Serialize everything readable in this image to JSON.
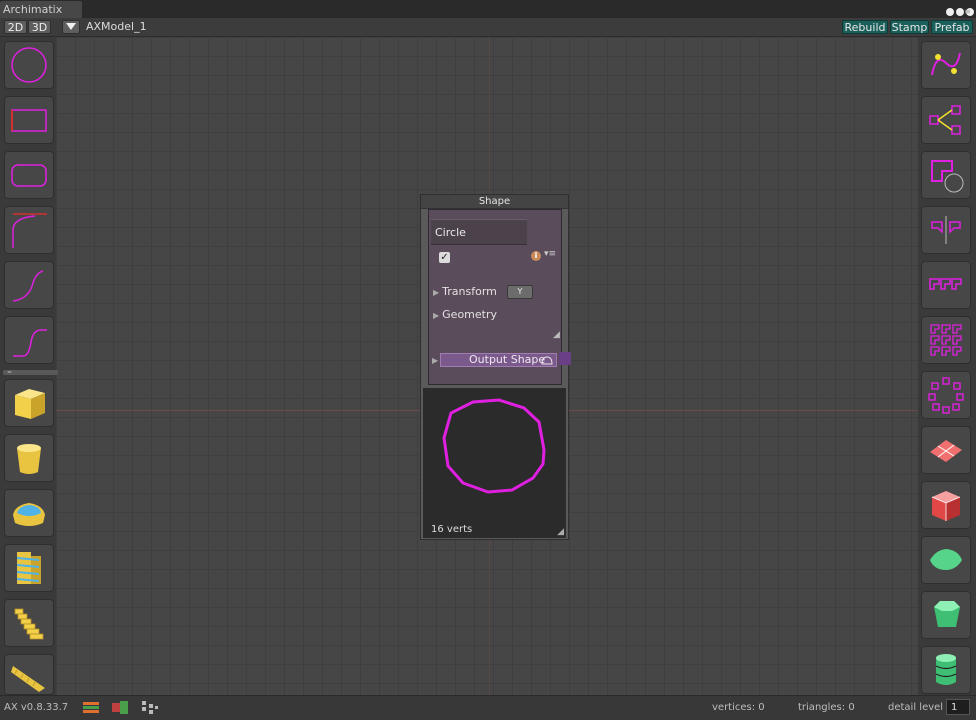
{
  "window": {
    "tab_title": "Archimatix"
  },
  "toolbar": {
    "btn_2d": "2D",
    "btn_3d": "3D",
    "model_name": "AXModel_1",
    "rebuild": "Rebuild",
    "stamp": "Stamp",
    "prefab": "Prefab"
  },
  "left_palette": {
    "shape_tools": [
      "circle-icon",
      "rectangle-icon",
      "rounded-rectangle-icon",
      "fillet-curve-icon",
      "arc-curve-icon",
      "s-curve-icon"
    ],
    "mesh_tools": [
      "box-icon",
      "cylinder-icon",
      "extrude-icon",
      "floor-stack-icon",
      "stair-icon",
      "ramp-icon"
    ]
  },
  "right_palette": {
    "tools": [
      "spline-icon",
      "shape-merger-icon",
      "shape-offset-icon",
      "mirror-icon",
      "linear-repeater-icon",
      "grid-repeater-icon",
      "radial-repeater-icon",
      "plane-icon",
      "cube-icon",
      "polygon-icon",
      "green-prism-icon",
      "green-cylinder-icon"
    ]
  },
  "node": {
    "title": "Shape",
    "name": "Circle",
    "enabled_check": "✓",
    "info_glyph": "i",
    "menu_glyph": "▾≡",
    "transform_label": "Transform",
    "transform_axis": "Y",
    "geometry_label": "Geometry",
    "output_label": "Output Shape",
    "verts_label": "16 verts"
  },
  "status": {
    "version": "AX v0.8.33.7",
    "vertices": "vertices: 0",
    "triangles": "triangles: 0",
    "detail_label": "detail level",
    "detail_value": "1"
  },
  "colors": {
    "accent_magenta": "#e020e0",
    "teal_button": "#1b5f5a",
    "mesh_yellow": "#f2d04a",
    "mesh_green": "#55d48a"
  }
}
